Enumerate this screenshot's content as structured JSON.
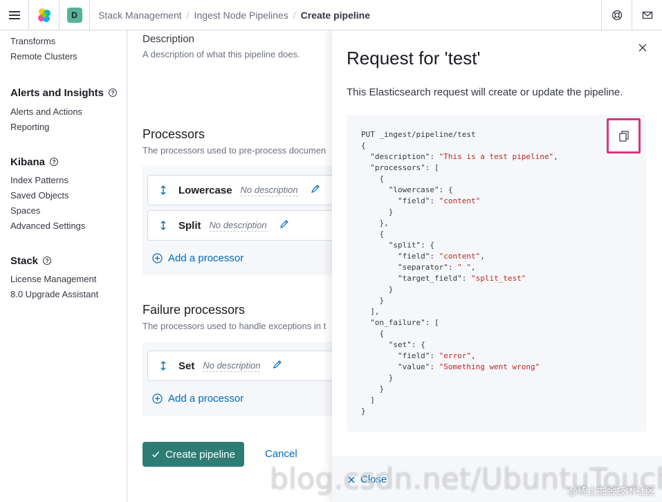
{
  "header": {
    "space_initial": "D",
    "breadcrumbs": [
      "Stack Management",
      "Ingest Node Pipelines",
      "Create pipeline"
    ]
  },
  "sidebar": {
    "items_top": [
      "Transforms",
      "Remote Clusters"
    ],
    "sections": [
      {
        "title": "Alerts and Insights",
        "items": [
          "Alerts and Actions",
          "Reporting"
        ]
      },
      {
        "title": "Kibana",
        "items": [
          "Index Patterns",
          "Saved Objects",
          "Spaces",
          "Advanced Settings"
        ]
      },
      {
        "title": "Stack",
        "items": [
          "License Management",
          "8.0 Upgrade Assistant"
        ]
      }
    ]
  },
  "form": {
    "description_label": "Description",
    "description_help": "A description of what this pipeline does.",
    "processors_title": "Processors",
    "processors_desc": "The processors used to pre-process documen",
    "processors": [
      {
        "name": "Lowercase",
        "desc": "No description"
      },
      {
        "name": "Split",
        "desc": "No description"
      }
    ],
    "add_processor": "Add a processor",
    "failure_title": "Failure processors",
    "failure_desc": "The processors used to handle exceptions in t",
    "failure_processors": [
      {
        "name": "Set",
        "desc": "No description"
      }
    ],
    "create_button": "Create pipeline",
    "cancel_button": "Cancel"
  },
  "flyout": {
    "title": "Request for 'test'",
    "description": "This Elasticsearch request will create or update the pipeline.",
    "close_label": "Close",
    "code_lines": [
      "PUT _ingest/pipeline/test",
      "{",
      "  \"description\": \"This is a test pipeline\",",
      "  \"processors\": [",
      "    {",
      "      \"lowercase\": {",
      "        \"field\": \"content\"",
      "      }",
      "    },",
      "    {",
      "      \"split\": {",
      "        \"field\": \"content\",",
      "        \"separator\": \" \",",
      "        \"target_field\": \"split_test\"",
      "      }",
      "    }",
      "  ],",
      "  \"on_failure\": [",
      "    {",
      "      \"set\": {",
      "        \"field\": \"error\",",
      "        \"value\": \"Something went wrong\"",
      "      }",
      "    }",
      "  ]",
      "}"
    ]
  },
  "watermark": {
    "url": "blog.csdn.net/UbuntuTouch",
    "badge": "@稀土掘金技术社区"
  },
  "colors": {
    "primary": "#2e7d74",
    "link": "#006bb8",
    "highlight": "#d6377e",
    "code_string": "#bd271e"
  }
}
